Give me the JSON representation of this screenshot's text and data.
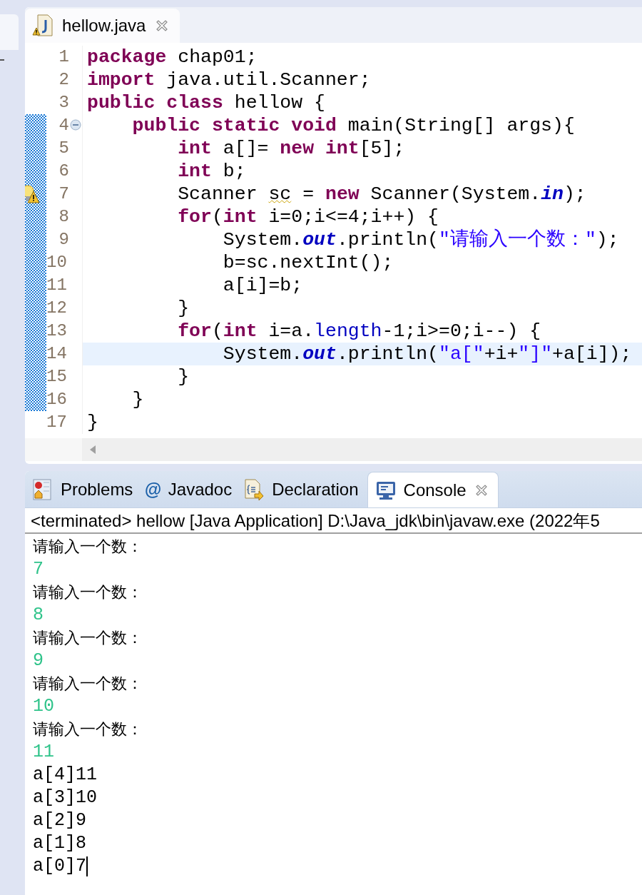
{
  "editor": {
    "tabs": [
      {
        "label": "hellow.java",
        "selected": true
      }
    ],
    "lines": [
      {
        "number": "1",
        "kind": "plain",
        "changed": false,
        "current": false,
        "tokens": [
          {
            "t": "package",
            "kind": "keyword"
          },
          {
            "t": " chap01;",
            "kind": "plain"
          }
        ]
      },
      {
        "number": "2",
        "kind": "plain",
        "changed": false,
        "current": false,
        "tokens": [
          {
            "t": "import",
            "kind": "keyword"
          },
          {
            "t": " java.util.Scanner;",
            "kind": "plain"
          }
        ]
      },
      {
        "number": "3",
        "kind": "plain",
        "changed": false,
        "current": false,
        "tokens": [
          {
            "t": "public class",
            "kind": "keyword"
          },
          {
            "t": " hellow {",
            "kind": "plain"
          }
        ]
      },
      {
        "number": "4",
        "kind": "fold",
        "changed": true,
        "current": false,
        "tokens": [
          {
            "t": "    public static void",
            "kind": "keyword"
          },
          {
            "t": " main(String[] args){",
            "kind": "plain"
          }
        ]
      },
      {
        "number": "5",
        "kind": "plain",
        "changed": true,
        "current": false,
        "tokens": [
          {
            "t": "        int",
            "kind": "keyword"
          },
          {
            "t": " a[]= ",
            "kind": "plain"
          },
          {
            "t": "new int",
            "kind": "keyword"
          },
          {
            "t": "[5];",
            "kind": "plain"
          }
        ]
      },
      {
        "number": "6",
        "kind": "plain",
        "changed": true,
        "current": false,
        "tokens": [
          {
            "t": "        int",
            "kind": "keyword"
          },
          {
            "t": " b;",
            "kind": "plain"
          }
        ]
      },
      {
        "number": "7",
        "kind": "warning",
        "changed": true,
        "current": false,
        "tokens": [
          {
            "t": "        Scanner ",
            "kind": "plain"
          },
          {
            "t": "sc",
            "kind": "warning"
          },
          {
            "t": " = ",
            "kind": "plain"
          },
          {
            "t": "new",
            "kind": "keyword"
          },
          {
            "t": " Scanner(System.",
            "kind": "plain"
          },
          {
            "t": "in",
            "kind": "static"
          },
          {
            "t": ");",
            "kind": "plain"
          }
        ]
      },
      {
        "number": "8",
        "kind": "plain",
        "changed": true,
        "current": false,
        "tokens": [
          {
            "t": "        for",
            "kind": "keyword"
          },
          {
            "t": "(",
            "kind": "plain"
          },
          {
            "t": "int",
            "kind": "keyword"
          },
          {
            "t": " i=0;i<=4;i++) {",
            "kind": "plain"
          }
        ]
      },
      {
        "number": "9",
        "kind": "plain",
        "changed": true,
        "current": false,
        "tokens": [
          {
            "t": "            System.",
            "kind": "plain"
          },
          {
            "t": "out",
            "kind": "static"
          },
          {
            "t": ".println(",
            "kind": "plain"
          },
          {
            "t": "\"请输入一个数：\"",
            "kind": "string"
          },
          {
            "t": ");",
            "kind": "plain"
          }
        ]
      },
      {
        "number": "10",
        "kind": "plain",
        "changed": true,
        "current": false,
        "tokens": [
          {
            "t": "            b=sc.nextInt();",
            "kind": "plain"
          }
        ]
      },
      {
        "number": "11",
        "kind": "plain",
        "changed": true,
        "current": false,
        "tokens": [
          {
            "t": "            a[i]=b;",
            "kind": "plain"
          }
        ]
      },
      {
        "number": "12",
        "kind": "plain",
        "changed": true,
        "current": false,
        "tokens": [
          {
            "t": "        }",
            "kind": "plain"
          }
        ]
      },
      {
        "number": "13",
        "kind": "plain",
        "changed": true,
        "current": false,
        "tokens": [
          {
            "t": "        for",
            "kind": "keyword"
          },
          {
            "t": "(",
            "kind": "plain"
          },
          {
            "t": "int",
            "kind": "keyword"
          },
          {
            "t": " i=a.",
            "kind": "plain"
          },
          {
            "t": "length",
            "kind": "field"
          },
          {
            "t": "-1;i>=0;i--) {",
            "kind": "plain"
          }
        ]
      },
      {
        "number": "14",
        "kind": "plain",
        "changed": true,
        "current": true,
        "tokens": [
          {
            "t": "            System.",
            "kind": "plain"
          },
          {
            "t": "out",
            "kind": "static"
          },
          {
            "t": ".println(",
            "kind": "plain"
          },
          {
            "t": "\"a[\"",
            "kind": "string"
          },
          {
            "t": "+i+",
            "kind": "plain"
          },
          {
            "t": "\"]\"",
            "kind": "string"
          },
          {
            "t": "+a[i]);",
            "kind": "plain"
          }
        ]
      },
      {
        "number": "15",
        "kind": "plain",
        "changed": true,
        "current": false,
        "tokens": [
          {
            "t": "        }",
            "kind": "plain"
          }
        ]
      },
      {
        "number": "16",
        "kind": "plain",
        "changed": true,
        "current": false,
        "tokens": [
          {
            "t": "    }",
            "kind": "plain"
          }
        ]
      },
      {
        "number": "17",
        "kind": "plain",
        "changed": false,
        "current": false,
        "tokens": [
          {
            "t": "}",
            "kind": "plain"
          }
        ]
      }
    ]
  },
  "views": {
    "tabs": [
      {
        "label": "Problems",
        "kind": "problems",
        "selected": false
      },
      {
        "label": "Javadoc",
        "kind": "javadoc",
        "icon_char": "@",
        "selected": false
      },
      {
        "label": "Declaration",
        "kind": "declaration",
        "selected": false
      },
      {
        "label": "Console",
        "kind": "console",
        "selected": true
      }
    ],
    "console": {
      "header": "<terminated> hellow [Java Application] D:\\Java_jdk\\bin\\javaw.exe (2022年5",
      "lines": [
        {
          "text": "请输入一个数：",
          "kind": "output"
        },
        {
          "text": "7",
          "kind": "input"
        },
        {
          "text": "请输入一个数：",
          "kind": "output"
        },
        {
          "text": "8",
          "kind": "input"
        },
        {
          "text": "请输入一个数：",
          "kind": "output"
        },
        {
          "text": "9",
          "kind": "input"
        },
        {
          "text": "请输入一个数：",
          "kind": "output"
        },
        {
          "text": "10",
          "kind": "input"
        },
        {
          "text": "请输入一个数：",
          "kind": "output"
        },
        {
          "text": "11",
          "kind": "input"
        },
        {
          "text": "a[4]11",
          "kind": "output"
        },
        {
          "text": "a[3]10",
          "kind": "output"
        },
        {
          "text": "a[2]9",
          "kind": "output"
        },
        {
          "text": "a[1]8",
          "kind": "output"
        },
        {
          "text": "a[0]7",
          "kind": "output"
        }
      ],
      "cursor": true
    }
  }
}
